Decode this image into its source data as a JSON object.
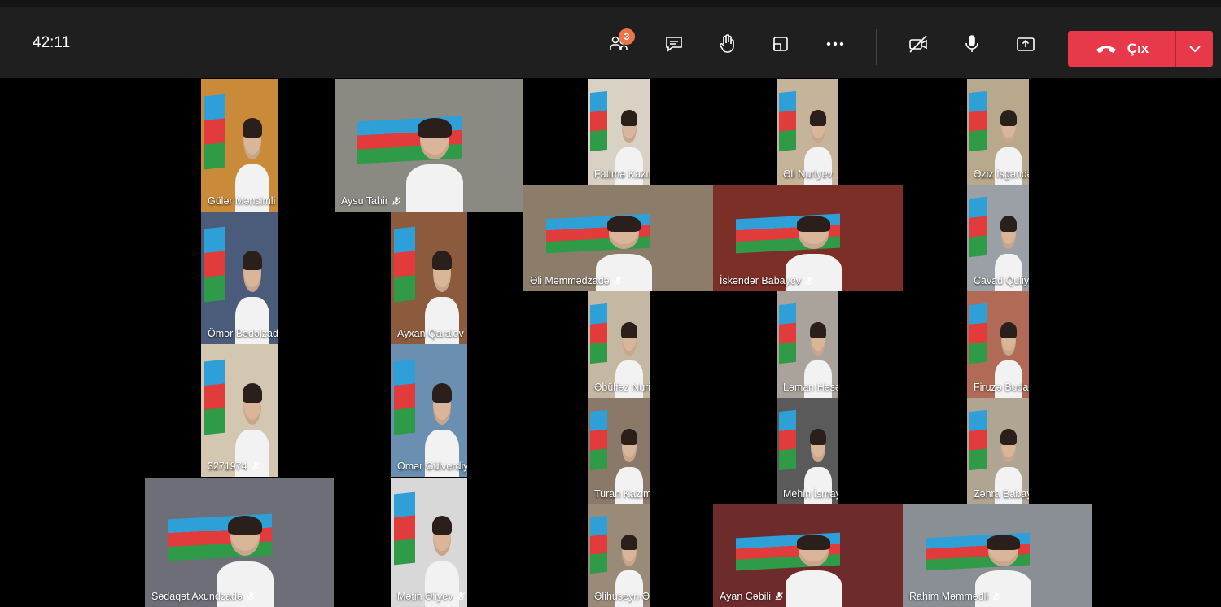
{
  "toolbar": {
    "timer": "42:11",
    "participants_count": "3",
    "leave_label": "Çıx"
  },
  "colors": {
    "leave_button": "#e8394b",
    "badge": "#e97548",
    "flag_blue": "#2f9fd8",
    "flag_red": "#e23b3b",
    "flag_green": "#2f9a48"
  },
  "icons": [
    "people-icon",
    "chat-icon",
    "raise-hand-icon",
    "view-icon",
    "more-icon",
    "camera-off-icon",
    "mic-icon",
    "share-screen-icon",
    "phone-hangup-icon",
    "chevron-down-icon",
    "mic-small-icon"
  ],
  "participants": [
    "Gülər Mənsimli",
    "Aysu Tahir",
    "Fatimə Kazımzadə",
    "Əli Nuriyev",
    "Əziz İsgəndərli",
    "Əli Məmmədzadə",
    "İskəndər Babayev",
    "Cavad Quliyev",
    "Ömər Bədəlzadə",
    "Ayxan Qaralov",
    "Əbülfəz Nuri",
    "Ləman Həsənova",
    "Firuzə Budaqlı",
    "3271974",
    "Ömər Gülverdiyev",
    "Turan Kazimli",
    "Mehin İsmayıllı",
    "Zəhra Babayeva",
    "Sədaqət Axundzadə",
    "Mətin Əliyev",
    "Əlihuseyn Əmiraslanov",
    "Ayan Cəbili",
    "Rahim Məmmədli"
  ]
}
